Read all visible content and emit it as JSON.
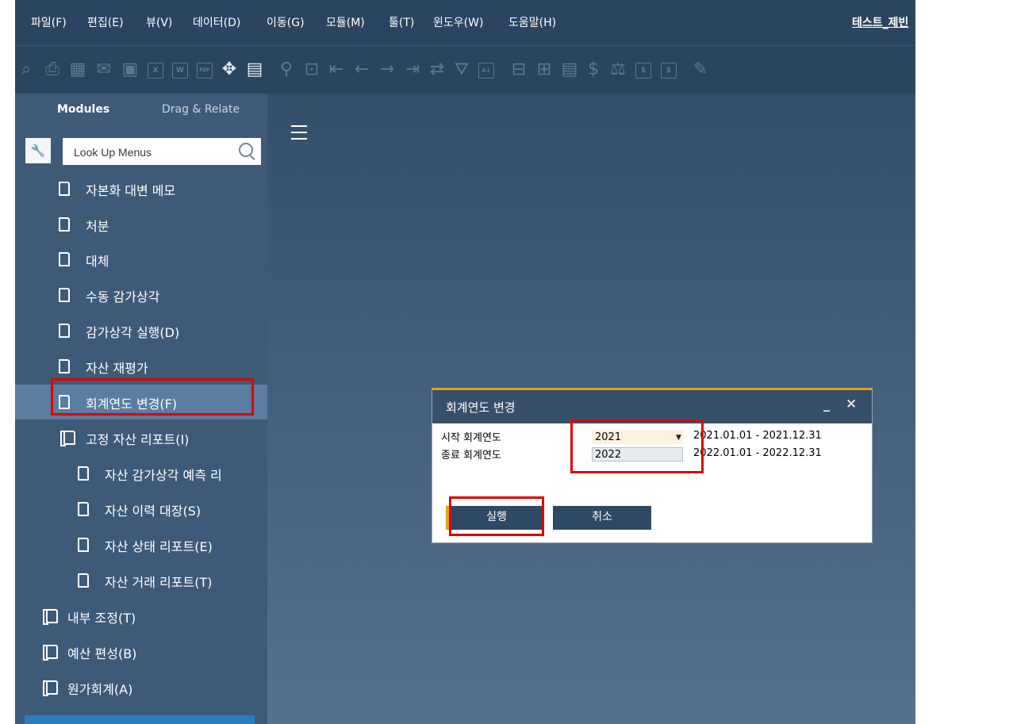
{
  "menu": [
    "파일(F)",
    "편집(E)",
    "뷰(V)",
    "데이터(D)",
    "이동(G)",
    "모듈(M)",
    "툴(T)",
    "윈도우(W)",
    "도움말(H)"
  ],
  "company": "테스트_제빈",
  "sidebar": {
    "tab_modules": "Modules",
    "tab_drag": "Drag & Relate",
    "search_placeholder": "Look Up Menus",
    "items": [
      {
        "label": "자본화 대변 메모"
      },
      {
        "label": "처분"
      },
      {
        "label": "대체"
      },
      {
        "label": "수동 감가상각"
      },
      {
        "label": "감가상각 실행(D)"
      },
      {
        "label": "자산 재평가"
      },
      {
        "label": "회계연도 변경(F)"
      },
      {
        "label": "고정 자산 리포트(I)"
      },
      {
        "label": "자산 감가상각 예측 리"
      },
      {
        "label": "자산 이력 대장(S)"
      },
      {
        "label": "자산 상태 리포트(E)"
      },
      {
        "label": "자산 거래 리포트(T)"
      },
      {
        "label": "내부 조정(T)"
      },
      {
        "label": "예산 편성(B)"
      },
      {
        "label": "원가회계(A)"
      }
    ]
  },
  "dialog": {
    "title": "회계연도 변경",
    "minimize": "_",
    "close": "✕",
    "start_label": "시작 회계연도",
    "start_value": "2021",
    "start_range": "2021.01.01 - 2021.12.31",
    "end_label": "종료 회계연도",
    "end_value": "2022",
    "end_range": "2022.01.01 - 2022.12.31",
    "run_label": "실행",
    "cancel_label": "취소"
  },
  "colors": {
    "highlight": "#e00000",
    "accent": "#e1a21b",
    "selected_row": "#5a7da0"
  }
}
